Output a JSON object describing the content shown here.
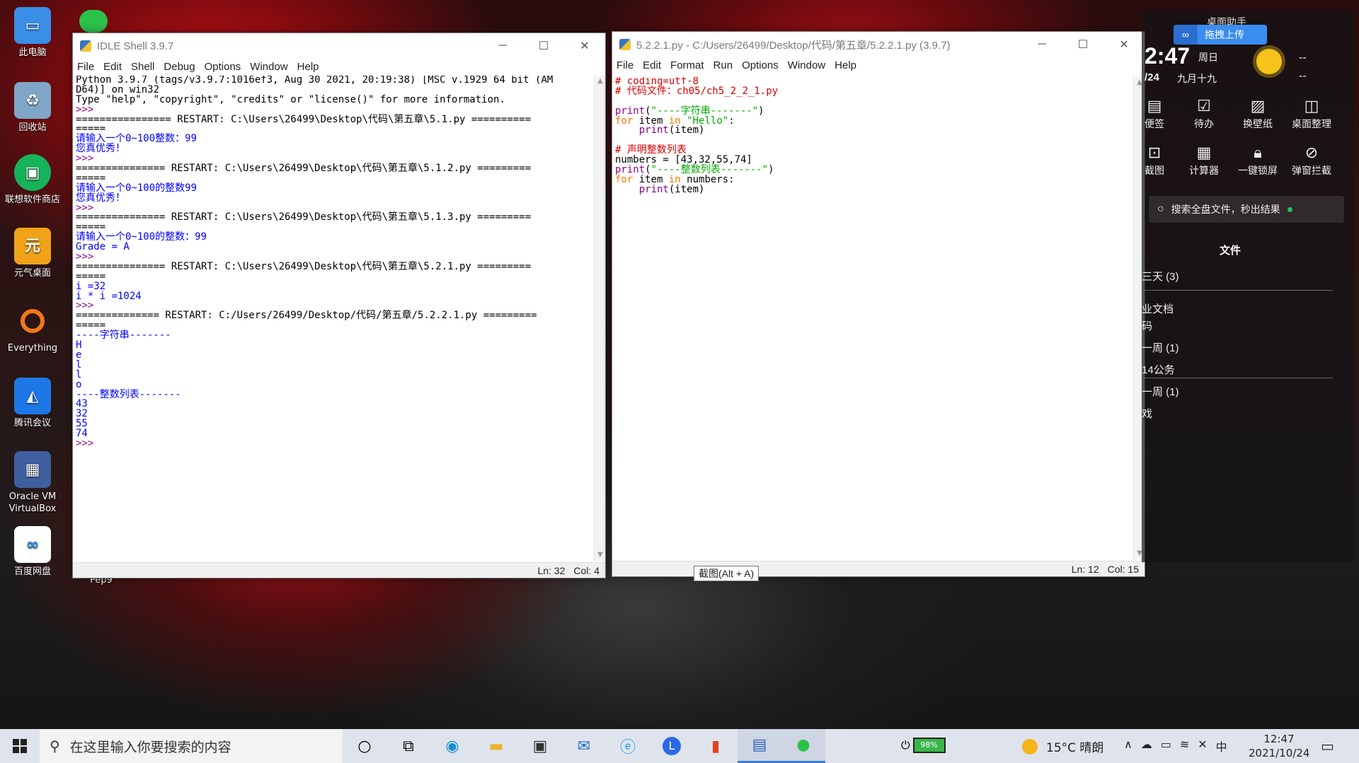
{
  "desktop_icons": [
    {
      "label": "此电脑",
      "icon": "computer-icon",
      "color": "#3a8ee6"
    },
    {
      "label": "回收站",
      "icon": "recycle-bin-icon",
      "color": "#7fa6c8"
    },
    {
      "label": "联想软件商店",
      "icon": "store-icon",
      "color": "#16b35a"
    },
    {
      "label": "元气桌面",
      "icon": "yuanqi-icon",
      "color": "#f0a318"
    },
    {
      "label": "Everything",
      "icon": "everything-icon",
      "color": "#f07818"
    },
    {
      "label": "腾讯会议",
      "icon": "meeting-icon",
      "color": "#1e77e6"
    },
    {
      "label": "Oracle VM VirtualBox",
      "icon": "virtualbox-icon",
      "color": "#3f5fa0"
    },
    {
      "label": "百度网盘",
      "icon": "baidu-disk-icon",
      "color": "#2b8de8"
    }
  ],
  "pep9_label": "Pep9",
  "shell": {
    "title": "IDLE Shell 3.9.7",
    "menu": [
      "File",
      "Edit",
      "Shell",
      "Debug",
      "Options",
      "Window",
      "Help"
    ],
    "lines": [
      {
        "text": "Python 3.9.7 (tags/v3.9.7:1016ef3, Aug 30 2021, 20:19:38) [MSC v.1929 64 bit (AM",
        "c": "black"
      },
      {
        "text": "D64)] on win32",
        "c": "black"
      },
      {
        "text": "Type \"help\", \"copyright\", \"credits\" or \"license()\" for more information.",
        "c": "black"
      },
      {
        "text": ">>> ",
        "c": "purple"
      },
      {
        "text": "================ RESTART: C:\\Users\\26499\\Desktop\\代码\\第五章\\5.1.py ==========",
        "c": "black"
      },
      {
        "text": "=====",
        "c": "black"
      },
      {
        "text": "请输入一个0~100整数：99",
        "c": "blue"
      },
      {
        "text": "您真优秀！",
        "c": "blue"
      },
      {
        "text": ">>> ",
        "c": "purple"
      },
      {
        "text": "=============== RESTART: C:\\Users\\26499\\Desktop\\代码\\第五章\\5.1.2.py =========",
        "c": "black"
      },
      {
        "text": "=====",
        "c": "black"
      },
      {
        "text": "请输入一个0~100的整数99",
        "c": "blue"
      },
      {
        "text": "您真优秀！",
        "c": "blue"
      },
      {
        "text": ">>> ",
        "c": "purple"
      },
      {
        "text": "=============== RESTART: C:\\Users\\26499\\Desktop\\代码\\第五章\\5.1.3.py =========",
        "c": "black"
      },
      {
        "text": "=====",
        "c": "black"
      },
      {
        "text": "请输入一个0~100的整数：99",
        "c": "blue"
      },
      {
        "text": "Grade = A",
        "c": "blue"
      },
      {
        "text": ">>> ",
        "c": "purple"
      },
      {
        "text": "=============== RESTART: C:\\Users\\26499\\Desktop\\代码\\第五章\\5.2.1.py =========",
        "c": "black"
      },
      {
        "text": "=====",
        "c": "black"
      },
      {
        "text": "i =32",
        "c": "blue"
      },
      {
        "text": "i * i =1024",
        "c": "blue"
      },
      {
        "text": ">>> ",
        "c": "purple"
      },
      {
        "text": "============== RESTART: C:/Users/26499/Desktop/代码/第五章/5.2.2.1.py =========",
        "c": "black"
      },
      {
        "text": "=====",
        "c": "black"
      },
      {
        "text": "----字符串-------",
        "c": "blue"
      },
      {
        "text": "H",
        "c": "blue"
      },
      {
        "text": "e",
        "c": "blue"
      },
      {
        "text": "l",
        "c": "blue"
      },
      {
        "text": "l",
        "c": "blue"
      },
      {
        "text": "o",
        "c": "blue"
      },
      {
        "text": "----整数列表-------",
        "c": "blue"
      },
      {
        "text": "43",
        "c": "blue"
      },
      {
        "text": "32",
        "c": "blue"
      },
      {
        "text": "55",
        "c": "blue"
      },
      {
        "text": "74",
        "c": "blue"
      },
      {
        "text": ">>> ",
        "c": "purple"
      }
    ],
    "status_ln": "Ln: 32",
    "status_col": "Col: 4"
  },
  "editor": {
    "title": "5.2.2.1.py - C:/Users/26499/Desktop/代码/第五章/5.2.2.1.py (3.9.7)",
    "menu": [
      "File",
      "Edit",
      "Format",
      "Run",
      "Options",
      "Window",
      "Help"
    ],
    "lines": [
      [
        {
          "t": "# coding=utf-8",
          "c": "red"
        }
      ],
      [
        {
          "t": "# 代码文件：ch05/ch5_2_2_1.py",
          "c": "red"
        }
      ],
      [
        {
          "t": "",
          "c": "black"
        }
      ],
      [
        {
          "t": "print",
          "c": "purple"
        },
        {
          "t": "(",
          "c": "black"
        },
        {
          "t": "\"----字符串-------\"",
          "c": "green"
        },
        {
          "t": ")",
          "c": "black"
        }
      ],
      [
        {
          "t": "for",
          "c": "orange"
        },
        {
          "t": " item ",
          "c": "black"
        },
        {
          "t": "in",
          "c": "orange"
        },
        {
          "t": " ",
          "c": "black"
        },
        {
          "t": "\"Hello\"",
          "c": "green"
        },
        {
          "t": ":",
          "c": "black"
        }
      ],
      [
        {
          "t": "    ",
          "c": "black"
        },
        {
          "t": "print",
          "c": "purple"
        },
        {
          "t": "(item)",
          "c": "black"
        }
      ],
      [
        {
          "t": "",
          "c": "black"
        }
      ],
      [
        {
          "t": "# 声明整数列表",
          "c": "red"
        }
      ],
      [
        {
          "t": "numbers = [43,32,55,74]",
          "c": "black"
        }
      ],
      [
        {
          "t": "print",
          "c": "purple"
        },
        {
          "t": "(",
          "c": "black"
        },
        {
          "t": "\"----整数列表-------\"",
          "c": "green"
        },
        {
          "t": ")",
          "c": "black"
        }
      ],
      [
        {
          "t": "for",
          "c": "orange"
        },
        {
          "t": " item ",
          "c": "black"
        },
        {
          "t": "in",
          "c": "orange"
        },
        {
          "t": " numbers:",
          "c": "black"
        }
      ],
      [
        {
          "t": "    ",
          "c": "black"
        },
        {
          "t": "print",
          "c": "purple"
        },
        {
          "t": "(item)",
          "c": "black"
        }
      ]
    ],
    "status_ln": "Ln: 12",
    "status_col": "Col: 15"
  },
  "tooltip": "截图(Alt + A)",
  "panel": {
    "header": "桌面助手",
    "upload_button": "拖拽上传",
    "time": "2:47",
    "weekday": "周日",
    "date": "/24",
    "lunar": "九月十九",
    "temp_placeholder": "--",
    "tools_row1": [
      "便签",
      "待办",
      "换壁纸",
      "桌面整理"
    ],
    "tools_row2": [
      "截图",
      "计算器",
      "一键锁屏",
      "弹窗拦截"
    ],
    "search_text": "搜索全盘文件，秒出结果",
    "files_title": "文件",
    "file_items": [
      "三天 (3)",
      "业文档",
      "码",
      "一周 (1)",
      "14公务",
      "一周 (1)",
      "戏"
    ]
  },
  "taskbar": {
    "search_placeholder": "在这里输入你要搜索的内容",
    "battery": "98%",
    "weather": "15°C 晴朗",
    "ime": "中",
    "time": "12:47",
    "date": "2021/10/24"
  }
}
